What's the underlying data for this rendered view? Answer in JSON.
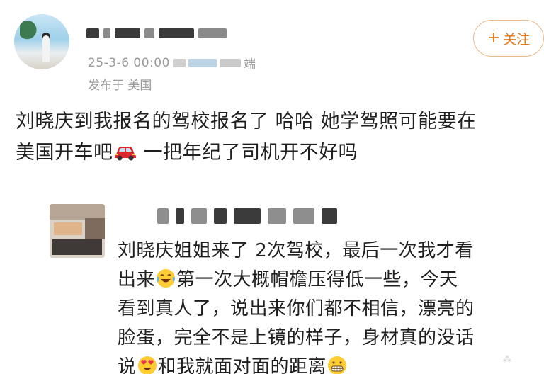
{
  "post": {
    "timestamp": "25-3-6 00:00",
    "device_suffix": "端",
    "location": "发布于 美国",
    "follow_label": "关注",
    "follow_plus": "+",
    "text_line1": "刘晓庆到我报名的驾校报名了 哈哈 她学驾照可能要在",
    "text_line2_a": "美国开车吧",
    "text_line2_b": " 一把年纪了司机开不好吗"
  },
  "comment": {
    "line1": "刘晓庆姐姐来了 2次驾校，最后一次我才看",
    "line2_a": "出来",
    "line2_b": "第一次大概帽檐压得低一些，今天",
    "line3": "看到真人了，说出来你们都不相信，漂亮的",
    "line4": "脸蛋，完全不是上镜的样子，身材真的没话",
    "line5_a": "说",
    "line5_b": "和我就面对面的距离"
  },
  "icons": {
    "car": "red-car-emoji",
    "laugh": "tears-of-joy-emoji",
    "heart_eyes": "heart-eyes-emoji",
    "grin": "grinning-emoji"
  },
  "colors": {
    "follow_text": "#e07b1a",
    "follow_border": "#e9b98a",
    "meta_text": "#9a9a9a"
  }
}
